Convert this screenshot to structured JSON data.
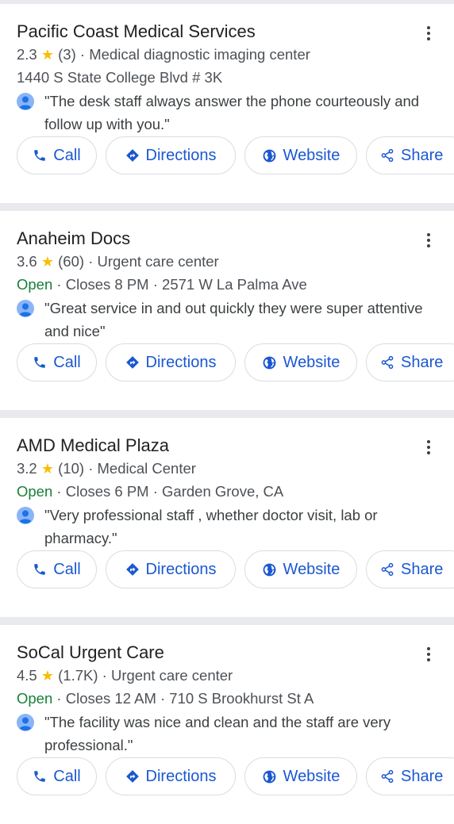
{
  "actions": {
    "call": "Call",
    "directions": "Directions",
    "website": "Website",
    "share": "Share"
  },
  "listings": [
    {
      "name": "Pacific Coast Medical Services",
      "rating": "2.3",
      "reviews": "(3)",
      "category": "Medical diagnostic imaging center",
      "open_status": "",
      "details": "1440 S State College Blvd # 3K",
      "review": "\"The desk staff always answer the phone courteously and follow up with you.\""
    },
    {
      "name": "Anaheim Docs",
      "rating": "3.6",
      "reviews": "(60)",
      "category": "Urgent care center",
      "open_status": "Open",
      "details": "Closes 8 PM · 2571 W La Palma Ave",
      "review": "\"Great service in and out quickly they were super attentive and nice\""
    },
    {
      "name": "AMD Medical Plaza",
      "rating": "3.2",
      "reviews": "(10)",
      "category": "Medical Center",
      "open_status": "Open",
      "details": "Closes 6 PM · Garden Grove, CA",
      "review": "\"Very professional staff , whether doctor visit, lab or pharmacy.\""
    },
    {
      "name": "SoCal Urgent Care",
      "rating": "4.5",
      "reviews": "(1.7K)",
      "category": "Urgent care center",
      "open_status": "Open",
      "details": "Closes 12 AM · 710 S Brookhurst St A",
      "review": "\"The facility was nice and clean and the staff are very professional.\""
    }
  ],
  "icons": {
    "star": "star-icon",
    "more": "more-vert-icon",
    "reviewer": "person-icon",
    "call": "phone-icon",
    "directions": "directions-icon",
    "website": "globe-icon",
    "share": "share-icon"
  },
  "colors": {
    "accent": "#1a58d2",
    "open": "#188038",
    "star": "#fbbc04",
    "separator": "#e8eaed"
  }
}
